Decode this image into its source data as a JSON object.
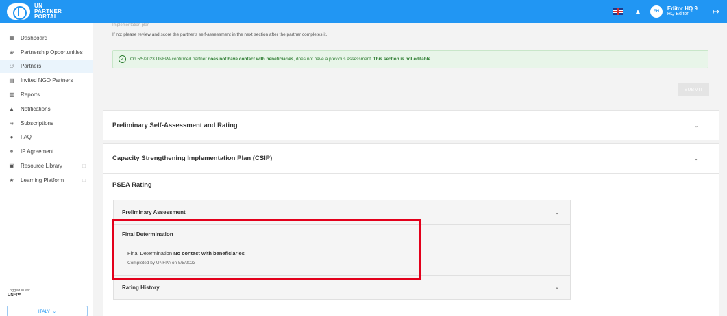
{
  "header": {
    "logo_line1": "UN",
    "logo_line2": "PARTNER",
    "logo_line3": "PORTAL",
    "avatar_initials": "EH",
    "user_name": "Editor HQ 9",
    "user_role": "HQ Editor"
  },
  "sidebar": {
    "items": [
      {
        "label": "Dashboard",
        "icon": "dashboard-icon",
        "glyph": "▦"
      },
      {
        "label": "Partnership Opportunities",
        "icon": "globe-icon",
        "glyph": "⊕"
      },
      {
        "label": "Partners",
        "icon": "partners-icon",
        "glyph": "⚇"
      },
      {
        "label": "Invited NGO Partners",
        "icon": "invited-icon",
        "glyph": "▤"
      },
      {
        "label": "Reports",
        "icon": "reports-icon",
        "glyph": "▥"
      },
      {
        "label": "Notifications",
        "icon": "bell-icon",
        "glyph": "▲"
      },
      {
        "label": "Subscriptions",
        "icon": "rss-icon",
        "glyph": "≋"
      },
      {
        "label": "FAQ",
        "icon": "help-icon",
        "glyph": "●"
      },
      {
        "label": "IP Agreement",
        "icon": "handshake-icon",
        "glyph": "⚭"
      },
      {
        "label": "Resource Library",
        "icon": "library-icon",
        "glyph": "▣"
      },
      {
        "label": "Learning Platform",
        "icon": "star-icon",
        "glyph": "★"
      }
    ],
    "logged_in_label": "Logged in as:",
    "logged_in_value": "UNFPA",
    "country": "ITALY"
  },
  "main": {
    "partial_text": "Implementation plan",
    "hint": "If no: please review and score the partner's self-assessment in the next section after the partner completes it.",
    "success_prefix": "On 5/5/2023 UNFPA confirmed partner ",
    "success_bold1": "does not have contact with beneficiaries",
    "success_middle": ", does not have a previous assessment. ",
    "success_bold2": "This section is not editable.",
    "submit_label": "SUBMIT",
    "section1": "Preliminary Self-Assessment and Rating",
    "section2": "Capacity Strengthening Implementation Plan (CSIP)",
    "psea_title": "PSEA Rating",
    "preliminary_assessment": "Preliminary Assessment",
    "final_title": "Final Determination",
    "final_label": "Final Determination ",
    "final_value": "No contact with beneficiaries",
    "completed_by": "Completed by UNFPA on 5/5/2023",
    "rating_history": "Rating History"
  },
  "colors": {
    "brand": "#2196f3",
    "success": "#2e7d32",
    "highlight": "#e3001b"
  }
}
